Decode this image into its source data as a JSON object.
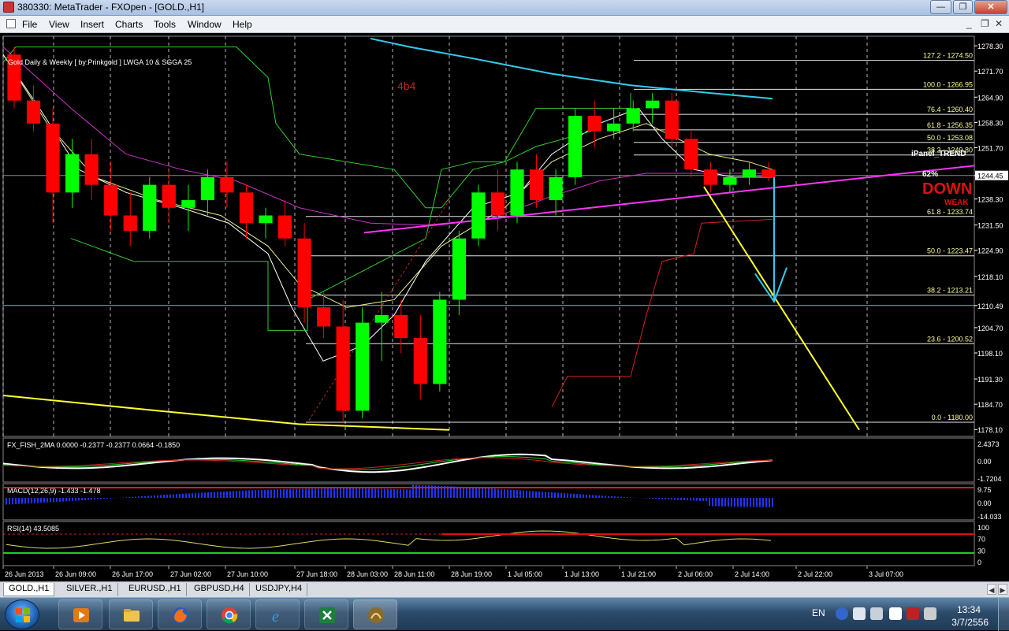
{
  "window": {
    "title": "380330: MetaTrader - FXOpen - [GOLD.,H1]"
  },
  "menu": [
    "File",
    "View",
    "Insert",
    "Charts",
    "Tools",
    "Window",
    "Help"
  ],
  "chart_data": {
    "type": "candlestick",
    "symbol": "GOLD.,H1",
    "indicator_label": "Gold Daily & Weekly [ by:Prinkgold ] LWGA 10  &  SGGA 25",
    "watermark_text": "4b4",
    "price_axis": [
      "1278.30",
      "1271.70",
      "1264.90",
      "1258.30",
      "1251.70",
      "1244.45",
      "1238.30",
      "1231.50",
      "1224.90",
      "1218.10",
      "1210.49",
      "1204.70",
      "1198.10",
      "1191.30",
      "1184.70",
      "1178.10"
    ],
    "current_price": "1244.45",
    "line_price": "1210.49",
    "fib_levels": [
      "127.2 - 1274.50",
      "100.0 - 1266.95",
      "76.4 - 1260.40",
      "61.8 - 1256.35",
      "50.0 - 1253.08",
      "38.2 - 1249.80",
      "61.8 - 1233.74",
      "50.0 - 1223.47",
      "38.2 - 1213.21",
      "23.6 - 1200.52",
      "0.0 - 1180.00"
    ],
    "ipanel": {
      "title": "iPanel_TREND",
      "pct": "62%",
      "signal": "DOWN",
      "strength": "WEAK"
    },
    "time_axis": [
      "26 Jun 2013",
      "26 Jun 09:00",
      "26 Jun 17:00",
      "27 Jun 02:00",
      "27 Jun 10:00",
      "27 Jun 18:00",
      "28 Jun 03:00",
      "28 Jun 11:00",
      "28 Jun 19:00",
      "1 Jul 05:00",
      "1 Jul 13:00",
      "1 Jul 21:00",
      "2 Jul 06:00",
      "2 Jul 14:00",
      "2 Jul 22:00",
      "3 Jul 07:00"
    ],
    "price_ylim": [
      1176.3,
      1280.8
    ],
    "candles": [
      {
        "o": 1276,
        "h": 1278,
        "l": 1262,
        "c": 1264
      },
      {
        "o": 1264,
        "h": 1268,
        "l": 1256,
        "c": 1258
      },
      {
        "o": 1258,
        "h": 1262,
        "l": 1232,
        "c": 1240
      },
      {
        "o": 1240,
        "h": 1254,
        "l": 1236,
        "c": 1250
      },
      {
        "o": 1250,
        "h": 1254,
        "l": 1238,
        "c": 1242
      },
      {
        "o": 1242,
        "h": 1248,
        "l": 1230,
        "c": 1234
      },
      {
        "o": 1234,
        "h": 1240,
        "l": 1226,
        "c": 1230
      },
      {
        "o": 1230,
        "h": 1244,
        "l": 1228,
        "c": 1242
      },
      {
        "o": 1242,
        "h": 1246,
        "l": 1232,
        "c": 1236
      },
      {
        "o": 1236,
        "h": 1242,
        "l": 1230,
        "c": 1238
      },
      {
        "o": 1238,
        "h": 1246,
        "l": 1234,
        "c": 1244
      },
      {
        "o": 1244,
        "h": 1248,
        "l": 1236,
        "c": 1240
      },
      {
        "o": 1240,
        "h": 1242,
        "l": 1228,
        "c": 1232
      },
      {
        "o": 1232,
        "h": 1236,
        "l": 1228,
        "c": 1234
      },
      {
        "o": 1234,
        "h": 1238,
        "l": 1226,
        "c": 1228
      },
      {
        "o": 1228,
        "h": 1232,
        "l": 1206,
        "c": 1210
      },
      {
        "o": 1210,
        "h": 1214,
        "l": 1202,
        "c": 1205
      },
      {
        "o": 1205,
        "h": 1212,
        "l": 1180,
        "c": 1183
      },
      {
        "o": 1183,
        "h": 1210,
        "l": 1181,
        "c": 1206
      },
      {
        "o": 1206,
        "h": 1214,
        "l": 1196,
        "c": 1208
      },
      {
        "o": 1208,
        "h": 1212,
        "l": 1198,
        "c": 1202
      },
      {
        "o": 1202,
        "h": 1208,
        "l": 1186,
        "c": 1190
      },
      {
        "o": 1190,
        "h": 1214,
        "l": 1188,
        "c": 1212
      },
      {
        "o": 1212,
        "h": 1230,
        "l": 1208,
        "c": 1228
      },
      {
        "o": 1228,
        "h": 1242,
        "l": 1226,
        "c": 1240
      },
      {
        "o": 1240,
        "h": 1246,
        "l": 1230,
        "c": 1234
      },
      {
        "o": 1234,
        "h": 1248,
        "l": 1232,
        "c": 1246
      },
      {
        "o": 1246,
        "h": 1250,
        "l": 1236,
        "c": 1238
      },
      {
        "o": 1238,
        "h": 1246,
        "l": 1234,
        "c": 1244
      },
      {
        "o": 1244,
        "h": 1262,
        "l": 1242,
        "c": 1260
      },
      {
        "o": 1260,
        "h": 1264,
        "l": 1252,
        "c": 1256
      },
      {
        "o": 1256,
        "h": 1262,
        "l": 1254,
        "c": 1258
      },
      {
        "o": 1258,
        "h": 1264,
        "l": 1256,
        "c": 1262
      },
      {
        "o": 1262,
        "h": 1266,
        "l": 1258,
        "c": 1264
      },
      {
        "o": 1264,
        "h": 1266,
        "l": 1252,
        "c": 1254
      },
      {
        "o": 1254,
        "h": 1256,
        "l": 1244,
        "c": 1246
      },
      {
        "o": 1246,
        "h": 1248,
        "l": 1240,
        "c": 1242
      },
      {
        "o": 1242,
        "h": 1246,
        "l": 1240,
        "c": 1244
      },
      {
        "o": 1244,
        "h": 1248,
        "l": 1242,
        "c": 1246
      },
      {
        "o": 1246,
        "h": 1248,
        "l": 1243,
        "c": 1244
      }
    ],
    "sub_windows": [
      {
        "label": "FX_FISH_2MA 0.0000 -0.2377 -0.2377 0.0664 -0.1850",
        "scale": [
          "2.4373",
          "0.00",
          "-1.7204"
        ]
      },
      {
        "label": "MACD(12,26,9) -1.433 -1.478",
        "scale": [
          "9.75",
          "0.00",
          "-14.033"
        ]
      },
      {
        "label": "RSI(14) 43.5085",
        "scale": [
          "100",
          "70",
          "30",
          "0"
        ]
      }
    ]
  },
  "tabs": [
    "GOLD.,H1",
    "SILVER.,H1",
    "EURUSD.,H1",
    "GBPUSD,H4",
    "USDJPY,H4"
  ],
  "taskbar": {
    "lang": "EN",
    "time": "13:34",
    "date": "3/7/2556"
  },
  "colors": {
    "bull": "#00ff00",
    "bear": "#ff0000",
    "grid": "#ffffff",
    "fib": "#ffffff",
    "fib_text": "#ffff99",
    "trend_magenta": "#ff33ff",
    "cyan": "#33ccee",
    "yellow": "#ffff33"
  }
}
